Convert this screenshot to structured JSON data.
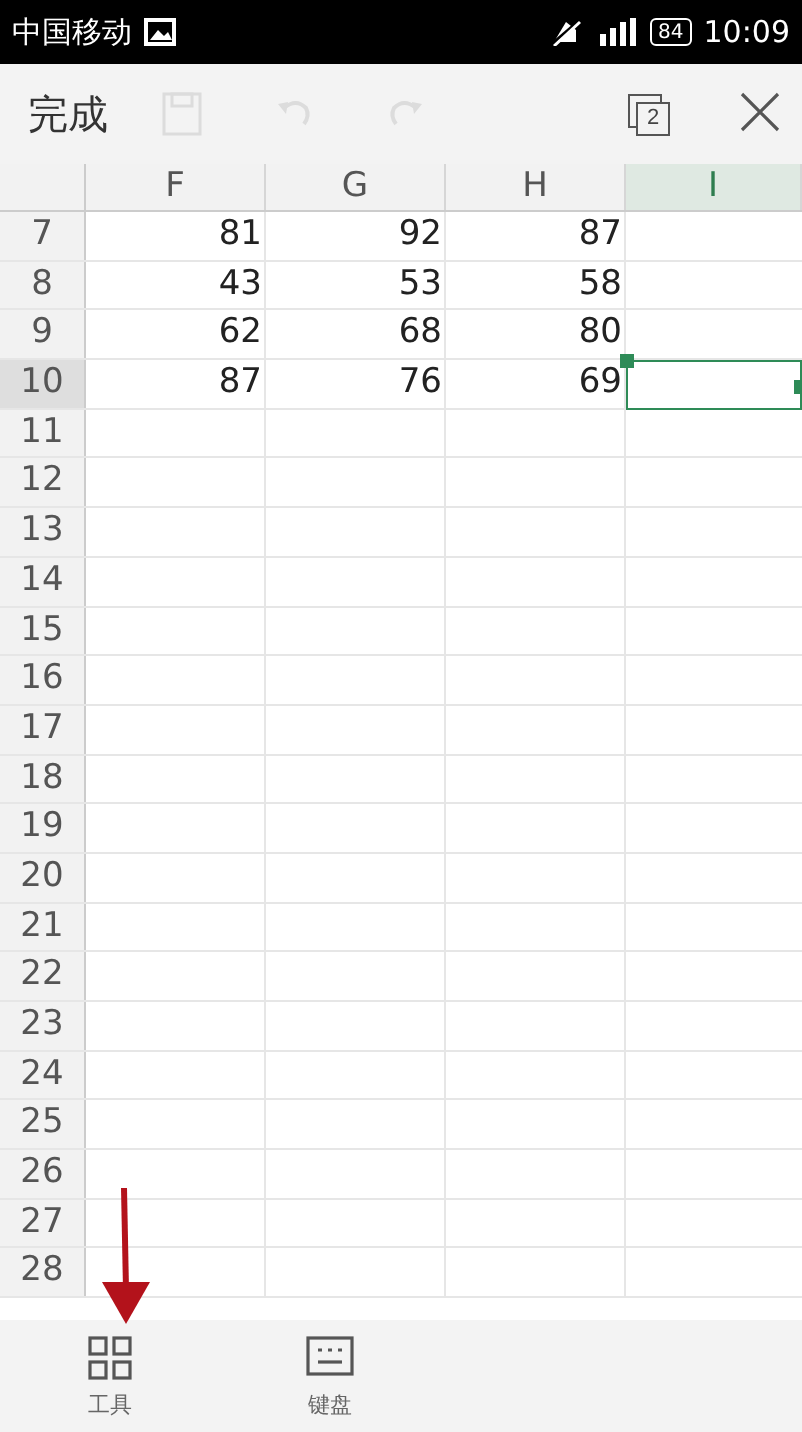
{
  "status_bar": {
    "carrier": "中国移动",
    "battery": "84",
    "time": "10:09"
  },
  "toolbar": {
    "done": "完成",
    "actions": [
      {
        "kind": "save",
        "disabled": true
      },
      {
        "kind": "undo",
        "disabled": true
      },
      {
        "kind": "redo",
        "disabled": true
      }
    ],
    "tab_count": "2"
  },
  "sheet": {
    "columns": [
      {
        "label": "F",
        "selected": false
      },
      {
        "label": "G",
        "selected": false
      },
      {
        "label": "H",
        "selected": false
      },
      {
        "label": "I",
        "selected": true
      }
    ],
    "rows": [
      {
        "number": "7",
        "selected": false,
        "cells": [
          "81",
          "92",
          "87"
        ]
      },
      {
        "number": "8",
        "selected": false,
        "cells": [
          "43",
          "53",
          "58"
        ]
      },
      {
        "number": "9",
        "selected": false,
        "cells": [
          "62",
          "68",
          "80"
        ]
      },
      {
        "number": "10",
        "selected": true,
        "cells": [
          "87",
          "76",
          "69"
        ]
      },
      {
        "number": "11",
        "selected": false
      },
      {
        "number": "12",
        "selected": false
      },
      {
        "number": "13",
        "selected": false
      },
      {
        "number": "14",
        "selected": false
      },
      {
        "number": "15",
        "selected": false
      },
      {
        "number": "16",
        "selected": false
      },
      {
        "number": "17",
        "selected": false
      },
      {
        "number": "18",
        "selected": false
      },
      {
        "number": "19",
        "selected": false
      },
      {
        "number": "20",
        "selected": false
      },
      {
        "number": "21",
        "selected": false
      },
      {
        "number": "22",
        "selected": false
      },
      {
        "number": "23",
        "selected": false
      },
      {
        "number": "24",
        "selected": false
      },
      {
        "number": "25",
        "selected": false
      },
      {
        "number": "26",
        "selected": false
      },
      {
        "number": "27",
        "selected": false
      },
      {
        "number": "28",
        "selected": false
      }
    ]
  },
  "bottom_bar": {
    "items": [
      {
        "kind": "tools",
        "label": "工具"
      },
      {
        "kind": "keyboard",
        "label": "键盘"
      }
    ]
  }
}
